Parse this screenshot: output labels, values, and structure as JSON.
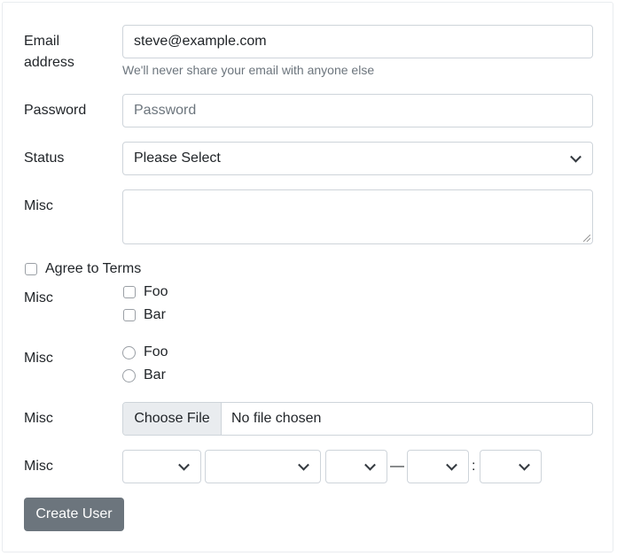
{
  "form": {
    "email": {
      "label_line1": "Email",
      "label_line2": "address",
      "value": "steve@example.com",
      "help": "We'll never share your email with anyone else"
    },
    "password": {
      "label": "Password",
      "placeholder": "Password",
      "value": ""
    },
    "status": {
      "label": "Status",
      "selected": "Please Select"
    },
    "misc_textarea": {
      "label": "Misc",
      "value": ""
    },
    "agree": {
      "label": "Agree to Terms",
      "checked": false
    },
    "misc_checkboxes": {
      "label": "Misc",
      "options": [
        {
          "label": "Foo",
          "checked": false
        },
        {
          "label": "Bar",
          "checked": false
        }
      ]
    },
    "misc_radios": {
      "label": "Misc",
      "options": [
        {
          "label": "Foo",
          "selected": false
        },
        {
          "label": "Bar",
          "selected": false
        }
      ]
    },
    "misc_file": {
      "label": "Misc",
      "button": "Choose File",
      "status": "No file chosen"
    },
    "misc_datetime": {
      "label": "Misc",
      "selects": [
        "",
        "",
        "",
        "",
        ""
      ],
      "range_separator": "—",
      "time_separator": ":"
    },
    "submit": {
      "label": "Create User",
      "color": "#6c757d"
    }
  }
}
